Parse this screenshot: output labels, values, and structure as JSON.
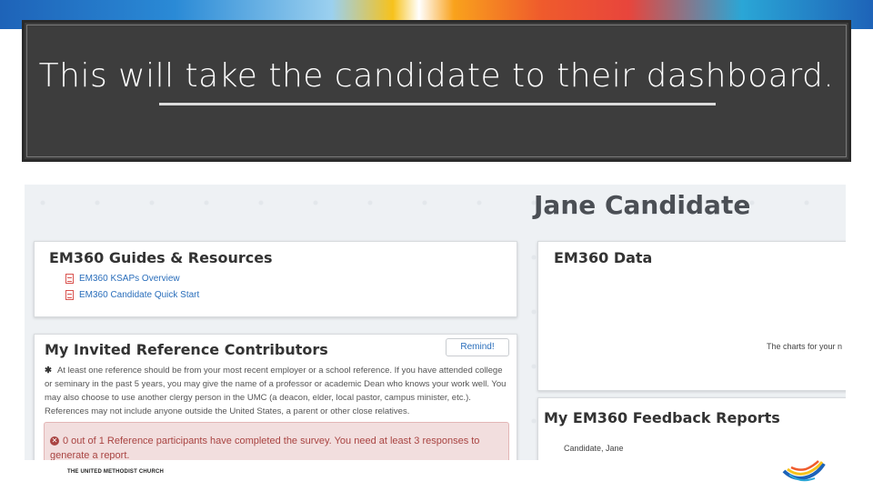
{
  "slide": {
    "title": "This will take the candidate to their dashboard.",
    "footer_logo_text": "THE UNITED METHODIST CHURCH"
  },
  "dashboard": {
    "candidate_name": "Jane Candidate",
    "guides": {
      "title": "EM360 Guides & Resources",
      "links": [
        "EM360 KSAPs Overview",
        "EM360 Candidate Quick Start"
      ]
    },
    "data": {
      "title": "EM360 Data",
      "charts_note": "The charts for your n"
    },
    "references": {
      "title": "My Invited Reference Contributors",
      "remind_label": "Remind!",
      "note": "At least one reference should be from your most recent employer or a school reference. If you have attended college or seminary in the past 5 years, you may give the name of a professor or academic Dean who knows your work well. You may also choose to use another clergy person in the UMC (a deacon, elder, local pastor, campus minister, etc.). References may not include anyone outside the United States, a parent or other close relatives.",
      "alert": "0 out of 1 Reference participants have completed the survey. You need at least 3 responses to generate a report."
    },
    "feedback": {
      "title": "My EM360 Feedback Reports",
      "candidate": "Candidate, Jane"
    }
  },
  "colors": {
    "title_bg": "#3d3d3d",
    "link": "#2a6ebb",
    "alert_bg": "#f2dede",
    "alert_text": "#a94442"
  }
}
